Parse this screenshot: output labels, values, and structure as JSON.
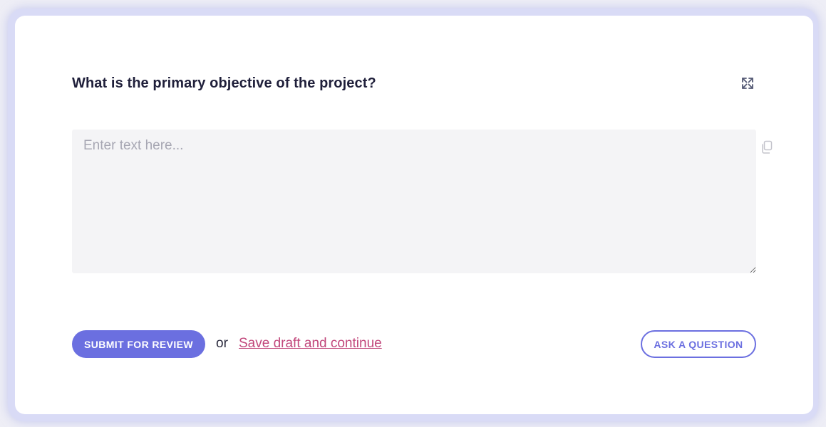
{
  "question": {
    "title": "What is the primary objective of the project?",
    "expand_icon": "expand-arrows-icon"
  },
  "answer": {
    "placeholder": "Enter text here...",
    "value": "",
    "copy_icon": "copy-icon"
  },
  "actions": {
    "submit_label": "SUBMIT FOR REVIEW",
    "or_text": "or",
    "draft_link_label": "Save draft and continue",
    "ask_label": "ASK A QUESTION"
  },
  "colors": {
    "accent": "#6b6fe0",
    "link": "#c2487c",
    "heading": "#1f1f3a",
    "field_background": "#f4f4f6",
    "frame": "#d9dbf6"
  }
}
